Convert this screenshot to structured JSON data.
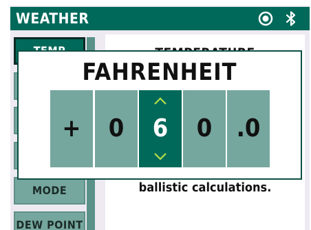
{
  "header": {
    "title": "WEATHER",
    "icons": [
      "record-icon",
      "bluetooth-icon"
    ]
  },
  "sidebar": {
    "items": [
      {
        "label": "TEMP",
        "active": true
      },
      {
        "label": ""
      },
      {
        "label": ""
      },
      {
        "label": ""
      },
      {
        "label": "MODE"
      },
      {
        "label": "DEW POINT"
      }
    ]
  },
  "content": {
    "heading": "TEMPERATURE",
    "body": "ballistic calculations."
  },
  "dialog": {
    "title": "FAHRENHEIT",
    "digits": [
      "+",
      "0",
      "6",
      "0",
      ".0"
    ],
    "selected_digit": "6",
    "up_icon": "chevron-up-icon",
    "down_icon": "chevron-down-icon"
  },
  "colors": {
    "accent": "#00695a",
    "tile": "#76a79e",
    "background": "#eeeaf2"
  }
}
